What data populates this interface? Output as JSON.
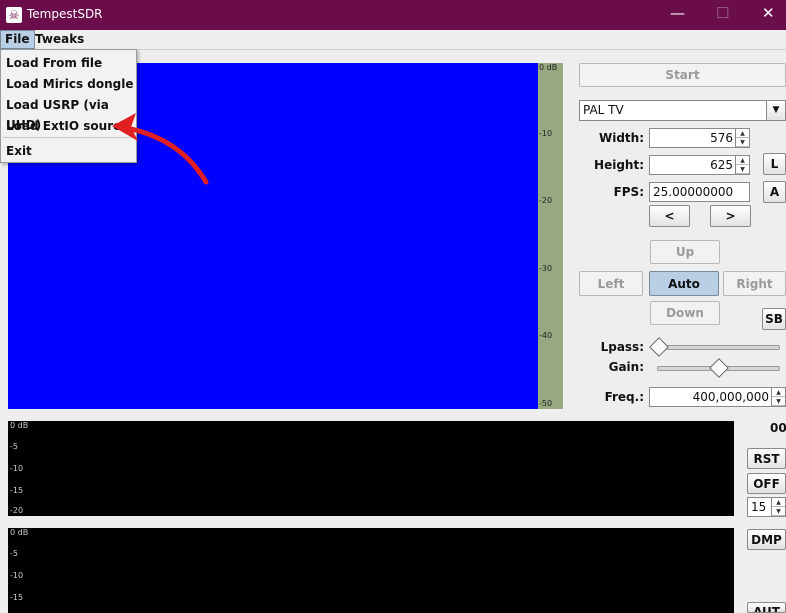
{
  "window": {
    "title": "TempestSDR",
    "controls": {
      "minimize": "—",
      "maximize": "☐",
      "close": "✕"
    }
  },
  "menubar": {
    "file": "File",
    "tweaks": "Tweaks"
  },
  "file_menu": {
    "items": [
      "Load From file",
      "Load Mirics dongle",
      "Load USRP (via UHD)",
      "Load ExtIO source"
    ],
    "exit": "Exit"
  },
  "waterfall": {
    "color": "#0000ff",
    "scale_labels": [
      "0 dB",
      "-10",
      "-20",
      "-30",
      "-40",
      "-50"
    ]
  },
  "spectrum_scale": [
    "0 dB",
    "-5",
    "-10",
    "-15",
    "-20"
  ],
  "spectrum2_scale": [
    "0 dB",
    "-5",
    "-10",
    "-15"
  ],
  "controls": {
    "start": "Start",
    "preset": "PAL TV",
    "width_label": "Width:",
    "width_value": "576",
    "height_label": "Height:",
    "height_value": "625",
    "fps_label": "FPS:",
    "fps_value": "25.00000000",
    "l_button": "L",
    "a_button": "A",
    "prev": "<",
    "next": ">",
    "up": "Up",
    "left": "Left",
    "auto": "Auto",
    "right": "Right",
    "down": "Down",
    "sb": "SB",
    "lpass_label": "Lpass:",
    "gain_label": "Gain:",
    "freq_label": "Freq.:",
    "freq_value": "400,000,000",
    "side_readout": "00",
    "rst": "RST",
    "off": "OFF",
    "frames_value": "15",
    "dmp": "DMP",
    "aut": "AUT"
  },
  "sliders": {
    "lpass_level": 0.0,
    "gain_level": 0.5
  },
  "annotation": {
    "arrow_color": "#e02020"
  }
}
